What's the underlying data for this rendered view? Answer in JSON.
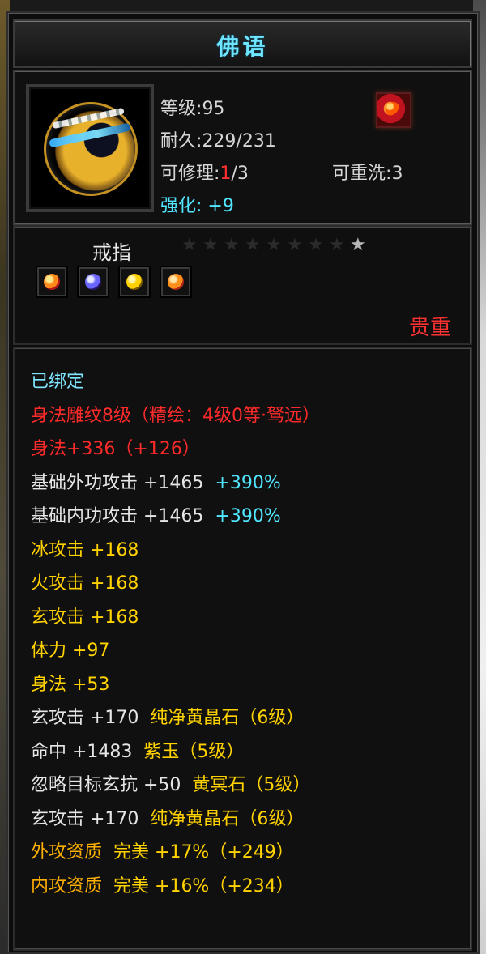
{
  "title": "佛语",
  "item": {
    "type": "戒指",
    "rarity": "贵重",
    "stats": {
      "level_label": "等级",
      "level_value": "95",
      "durability_label": "耐久",
      "durability_value": "229/231",
      "repairable_label": "可修理",
      "repairable_current": "1",
      "repairable_max": "/3",
      "rewashable_label": "可重洗",
      "rewashable_value": "3",
      "enhance_label": "强化",
      "enhance_value": "+9"
    },
    "stars": {
      "on": 1,
      "total": 9
    },
    "gems": [
      {
        "name": "gem-orange-icon"
      },
      {
        "name": "gem-purple-icon"
      },
      {
        "name": "gem-yellow-icon"
      },
      {
        "name": "gem-orange-icon"
      }
    ]
  },
  "attributes": [
    {
      "text": "已绑定",
      "color": "#7fe7ff"
    },
    {
      "text": "身法雕纹8级（精绘：4级0等·驽远）",
      "color": "#ff2a2a"
    },
    {
      "text": "身法+336（+126）",
      "color": "#ff2a2a"
    },
    {
      "text": "基础外功攻击 +1465",
      "color": "#e6e6e6",
      "extra": "+390%",
      "extra_color": "#52e6ff"
    },
    {
      "text": "基础内功攻击 +1465",
      "color": "#e6e6e6",
      "extra": "+390%",
      "extra_color": "#52e6ff"
    },
    {
      "text": "冰攻击 +168",
      "color": "#ffd200"
    },
    {
      "text": "火攻击 +168",
      "color": "#ffd200"
    },
    {
      "text": "玄攻击 +168",
      "color": "#ffd200"
    },
    {
      "text": "体力 +97",
      "color": "#ffd200"
    },
    {
      "text": "身法 +53",
      "color": "#ffd200"
    },
    {
      "text": "玄攻击 +170",
      "color": "#e6e6e6",
      "extra": "纯净黄晶石（6级）",
      "extra_color": "#ffd200"
    },
    {
      "text": "命中 +1483",
      "color": "#e6e6e6",
      "extra": "紫玉（5级）",
      "extra_color": "#ffd200"
    },
    {
      "text": "忽略目标玄抗 +50",
      "color": "#e6e6e6",
      "extra": "黄冥石（5级）",
      "extra_color": "#ffd200"
    },
    {
      "text": "玄攻击 +170",
      "color": "#e6e6e6",
      "extra": "纯净黄晶石（6级）",
      "extra_color": "#ffd200"
    },
    {
      "text": "外攻资质",
      "color": "#ffb000",
      "extra": "完美 +17%（+249）",
      "extra_color": "#ffd200"
    },
    {
      "text": "内攻资质",
      "color": "#ffb000",
      "extra": "完美 +16%（+234）",
      "extra_color": "#ffd200"
    }
  ]
}
